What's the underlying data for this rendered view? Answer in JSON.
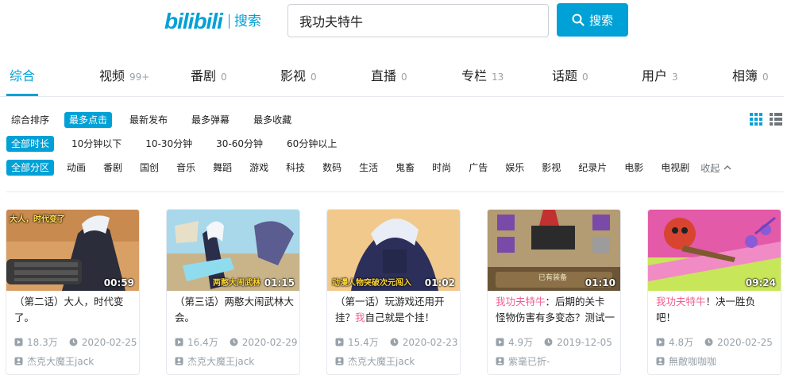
{
  "logo": {
    "mark": "bilibili",
    "sub": "搜索"
  },
  "search": {
    "value": "我功夫特牛",
    "button_label": "搜索"
  },
  "tabs": [
    {
      "label": "综合",
      "count": ""
    },
    {
      "label": "视频",
      "count": "99+"
    },
    {
      "label": "番剧",
      "count": "0"
    },
    {
      "label": "影视",
      "count": "0"
    },
    {
      "label": "直播",
      "count": "0"
    },
    {
      "label": "专栏",
      "count": "13"
    },
    {
      "label": "话题",
      "count": "0"
    },
    {
      "label": "用户",
      "count": "3"
    },
    {
      "label": "相簿",
      "count": "0"
    }
  ],
  "sort": [
    "综合排序",
    "最多点击",
    "最新发布",
    "最多弹幕",
    "最多收藏"
  ],
  "duration": [
    "全部时长",
    "10分钟以下",
    "10-30分钟",
    "30-60分钟",
    "60分钟以上"
  ],
  "zones": [
    "全部分区",
    "动画",
    "番剧",
    "国创",
    "音乐",
    "舞蹈",
    "游戏",
    "科技",
    "数码",
    "生活",
    "鬼畜",
    "时尚",
    "广告",
    "娱乐",
    "影视",
    "纪录片",
    "电影",
    "电视剧"
  ],
  "collapse_label": "收起",
  "videos": [
    {
      "title_prefix": "",
      "title_hl": "",
      "title_rest": "（第二话）大人，时代变了。",
      "thumb_text": "大人，时代变了",
      "duration": "00:59",
      "views": "18.3万",
      "date": "2020-02-25",
      "author": "杰克大魔王jack"
    },
    {
      "title_prefix": "",
      "title_hl": "",
      "title_rest": "（第三话）两憨大闹武林大会。",
      "thumb_text": "两憨大闹武林",
      "duration": "01:15",
      "views": "16.4万",
      "date": "2020-02-29",
      "author": "杰克大魔王jack"
    },
    {
      "title_prefix": "（第一话）玩游戏还用开挂？",
      "title_hl": "我",
      "title_rest": "自己就是个挂！",
      "thumb_text": "动漫人物突破次元闯入",
      "duration": "01:02",
      "views": "15.4万",
      "date": "2020-02-23",
      "author": "杰克大魔王jack"
    },
    {
      "title_prefix": "",
      "title_hl": "我功夫特牛",
      "title_rest": "：后期的关卡怪物伤害有多变态？测试一下",
      "thumb_text": "已有装备",
      "duration": "01:10",
      "views": "4.9万",
      "date": "2019-12-05",
      "author": "紫毫已折-"
    },
    {
      "title_prefix": "",
      "title_hl": "我功夫特牛",
      "title_rest": "！决一胜负吧！",
      "thumb_text": "",
      "duration": "09:24",
      "views": "4.8万",
      "date": "2020-02-25",
      "author": "無敵咖咖咖"
    }
  ],
  "colors": {
    "accent": "#00a1d6",
    "highlight": "#f25d8e",
    "muted": "#99a2aa"
  }
}
